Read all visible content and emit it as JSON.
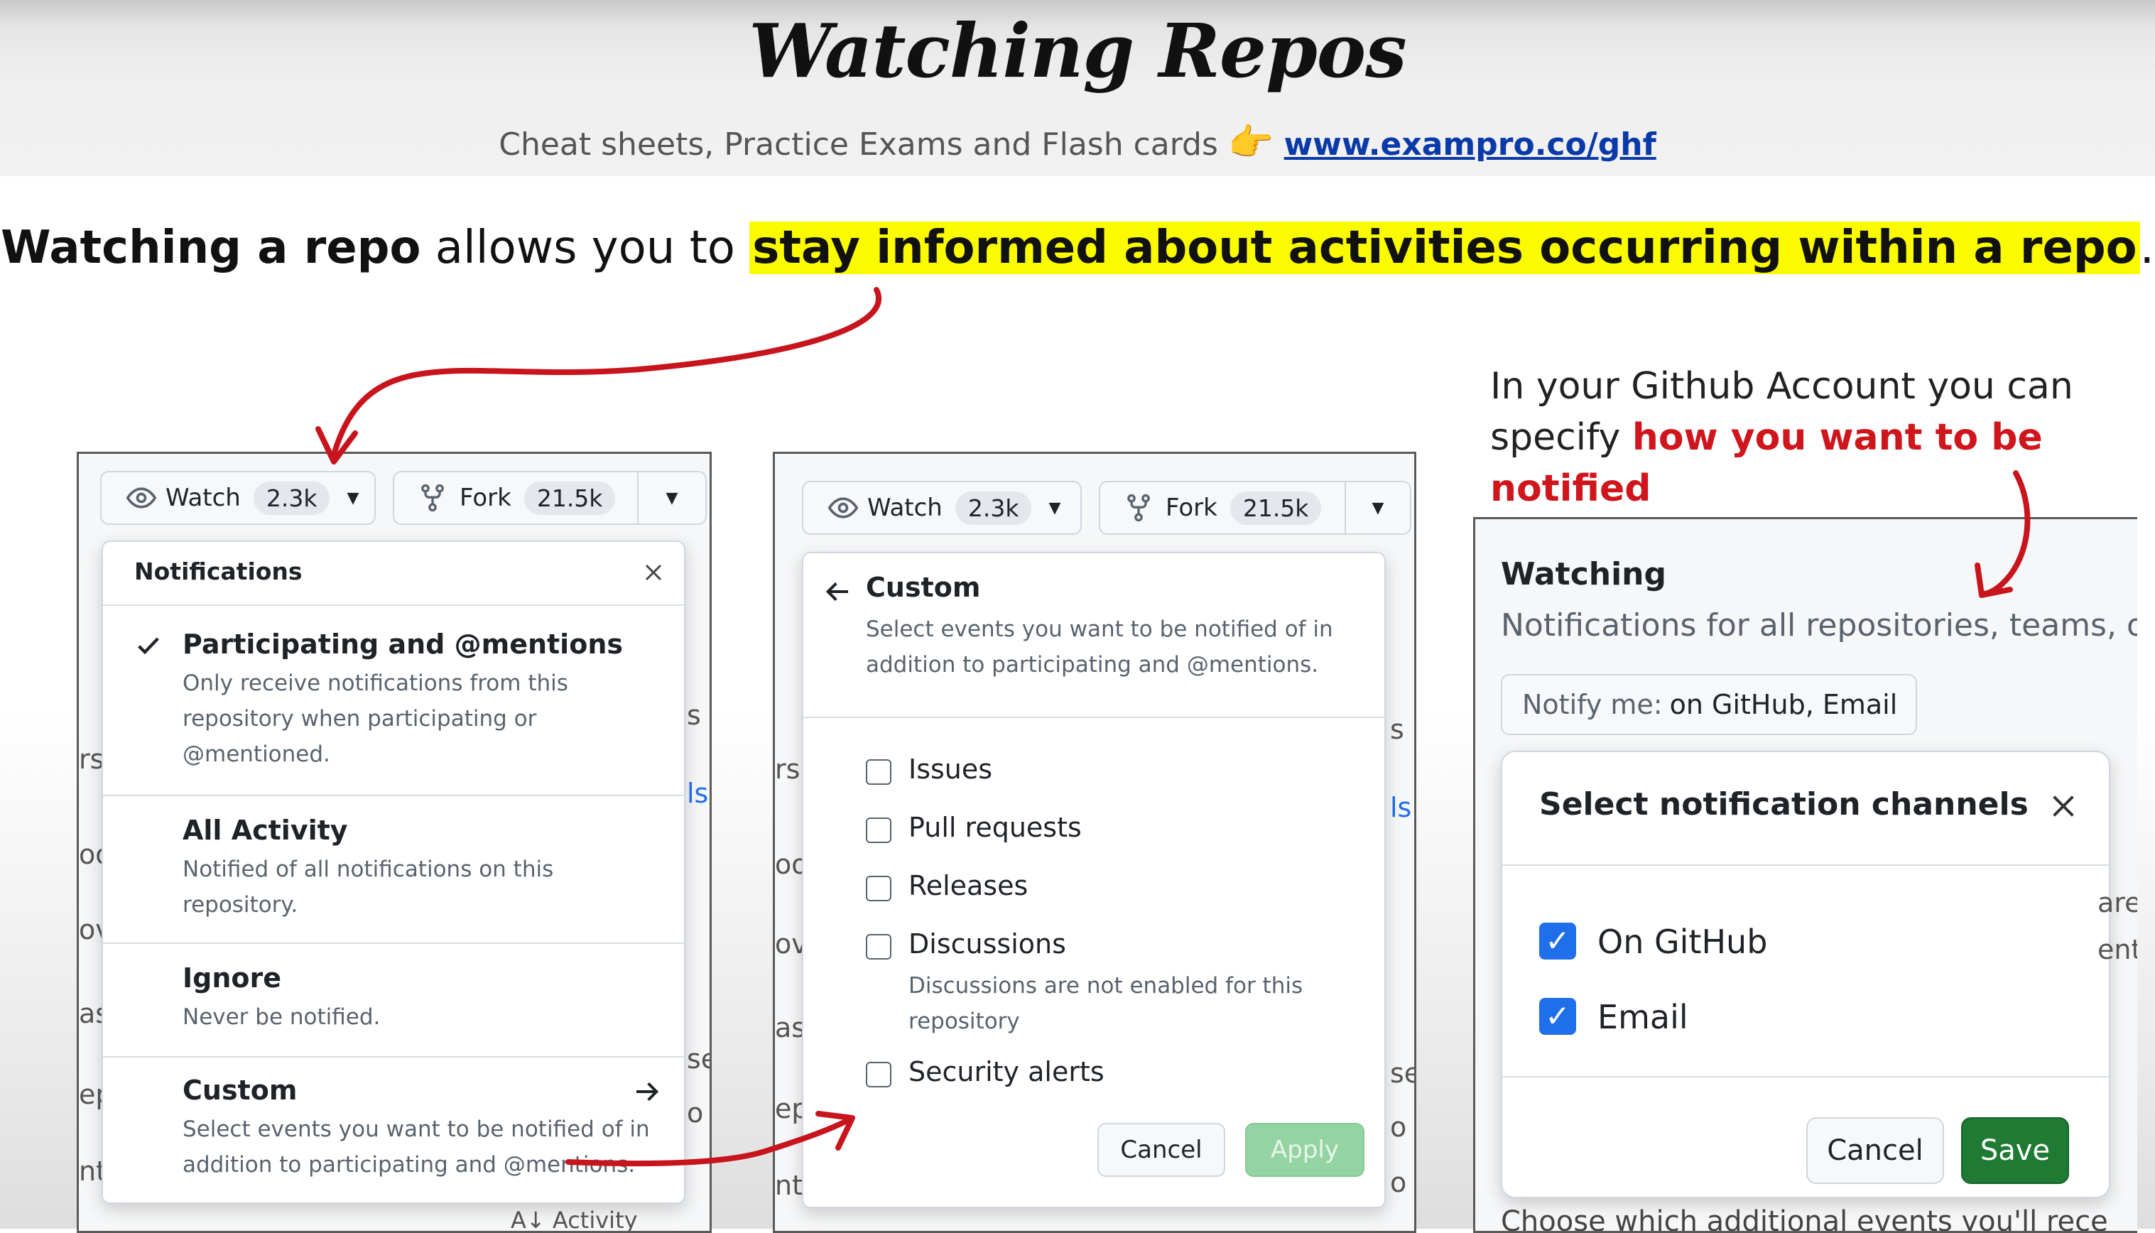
{
  "title": "Watching Repos",
  "subtitle": {
    "text": "Cheat sheets, Practice Exams and Flash cards",
    "hand_icon": "👉",
    "link": "www.exampro.co/ghf"
  },
  "headline": {
    "bold": "Watching a repo",
    "middle": " allows you to ",
    "highlight": "stay informed about activities occurring within a repo",
    "end": "."
  },
  "side_note": {
    "line1": "In your Github Account you can",
    "line2_prefix": "specify ",
    "line2_red": "how you want to be notified"
  },
  "colors": {
    "highlight": "#fbfb00",
    "red_arrow": "#c8141c",
    "save_green": "#1f7a33",
    "checkbox_blue": "#1f6feb"
  },
  "panel1": {
    "watch_label": "Watch",
    "watch_count": "2.3k",
    "fork_label": "Fork",
    "fork_count": "21.5k",
    "menu_title": "Notifications",
    "items": [
      {
        "title": "Participating and @mentions",
        "desc1": "Only receive notifications from this",
        "desc2": "repository when participating or",
        "desc3": "@mentioned."
      },
      {
        "title": "All Activity",
        "desc1": "Notified of all notifications on this",
        "desc2": "repository."
      },
      {
        "title": "Ignore",
        "desc1": "Never be notified."
      },
      {
        "title": "Custom",
        "desc1": "Select events you want to be notified of in",
        "desc2": "addition to participating and @mentions."
      }
    ],
    "ghost_bottom": "Activity"
  },
  "panel2": {
    "watch_label": "Watch",
    "watch_count": "2.3k",
    "fork_label": "Fork",
    "fork_count": "21.5k",
    "menu_title": "Custom",
    "menu_desc1": "Select events you want to be notified of in",
    "menu_desc2": "addition to participating and @mentions.",
    "options": [
      "Issues",
      "Pull requests",
      "Releases",
      "Discussions",
      "Security alerts"
    ],
    "discussions_note1": "Discussions are not enabled for this",
    "discussions_note2": "repository",
    "cancel": "Cancel",
    "apply": "Apply"
  },
  "panel3": {
    "heading": "Watching",
    "desc": "Notifications for all repositories, teams, or",
    "notify_prefix": "Notify me: ",
    "notify_value": "on GitHub, Email",
    "dialog_title": "Select notification channels",
    "channels": [
      "On GitHub",
      "Email"
    ],
    "cancel": "Cancel",
    "save": "Save",
    "bottom_cut": "Choose which additional events you'll rece"
  }
}
